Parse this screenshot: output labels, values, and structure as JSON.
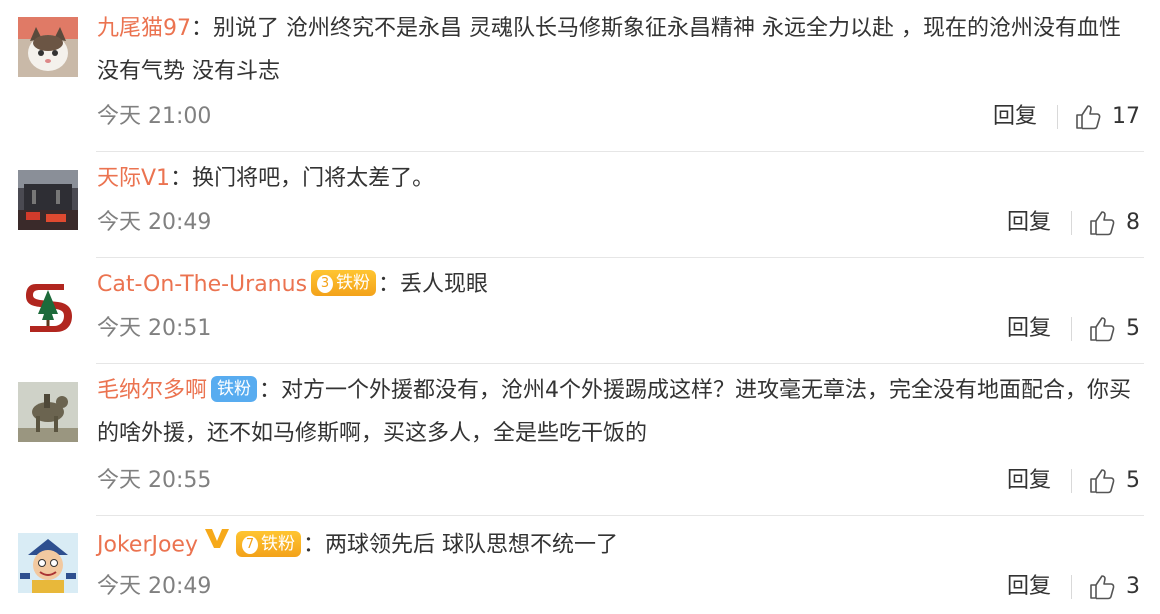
{
  "actions": {
    "reply_label": "回复"
  },
  "colors": {
    "name": "#eb7350",
    "meta": "#808080",
    "text": "#333333"
  },
  "comments": [
    {
      "user": "九尾猫97",
      "separator": "：",
      "text": "别说了  沧州终究不是永昌  灵魂队长马修斯象征永昌精神  永远全力以赴 ，现在的沧州没有血性  没有气势 没有斗志",
      "time": "今天 21:00",
      "likes": "17",
      "avatar_icon": "cat-avatar-icon"
    },
    {
      "user": "天际V1",
      "separator": "：",
      "text": "换门将吧，门将太差了。",
      "time": "今天 20:49",
      "likes": "8",
      "avatar_icon": "stadium-photo-avatar-icon"
    },
    {
      "user": "Cat-On-The-Uranus",
      "badge": {
        "number": "3",
        "label": "铁粉"
      },
      "separator": "：",
      "text": "丢人现眼",
      "time": "今天 20:51",
      "likes": "5",
      "avatar_icon": "stanford-s-tree-avatar-icon"
    },
    {
      "user": "毛纳尔多啊",
      "badge": {
        "label": "铁粉"
      },
      "separator": "：",
      "text": "对方一个外援都没有，沧州4个外援踢成这样？进攻毫无章法，完全没有地面配合，你买的啥外援，还不如马修斯啊，买这多人，全是些吃干饭的",
      "time": "今天 20:55",
      "likes": "5",
      "avatar_icon": "statue-avatar-icon"
    },
    {
      "user": "JokerJoey",
      "badge": {
        "number": "7",
        "label": "铁粉"
      },
      "separator": "：",
      "text": "两球领先后 球队思想不统一了",
      "time": "今天 20:49",
      "likes": "3",
      "avatar_icon": "cartoon-avatar-icon",
      "verified_icon": "verified-v-icon"
    }
  ]
}
